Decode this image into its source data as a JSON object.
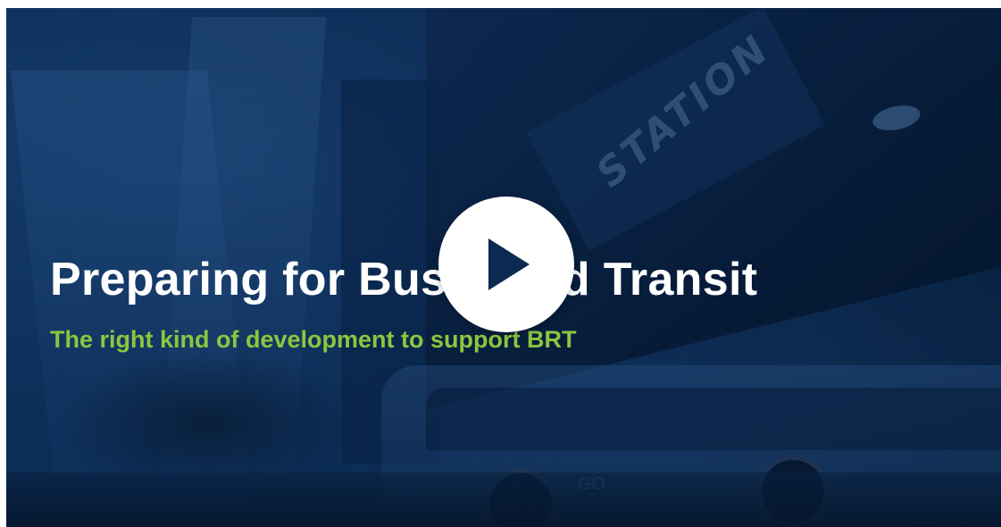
{
  "video": {
    "title": "Preparing for Bus Rapid Transit",
    "subtitle": "The right kind of development to support BRT",
    "background_sign_text": "STATION",
    "bus_text": "GO",
    "play_icon": "play-icon",
    "colors": {
      "overlay": "#0b2a52",
      "title": "#ffffff",
      "subtitle": "#8cc63f",
      "play_button": "#ffffff"
    }
  }
}
